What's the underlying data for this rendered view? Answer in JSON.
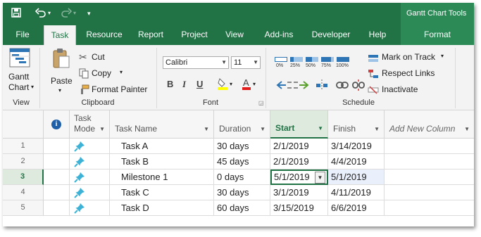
{
  "context_title": "Gantt Chart Tools",
  "tabs": [
    "File",
    "Task",
    "Resource",
    "Report",
    "Project",
    "View",
    "Add-ins",
    "Developer",
    "Help"
  ],
  "context_tab": "Format",
  "ribbon": {
    "view": {
      "gantt_line1": "Gantt",
      "gantt_line2": "Chart",
      "label": "View"
    },
    "clipboard": {
      "paste": "Paste",
      "cut": "Cut",
      "copy": "Copy",
      "format_painter": "Format Painter",
      "label": "Clipboard"
    },
    "font": {
      "name": "Calibri",
      "size": "11",
      "bold": "B",
      "italic": "I",
      "underline": "U",
      "label": "Font"
    },
    "schedule": {
      "percents": [
        "0%",
        "25%",
        "50%",
        "75%",
        "100%"
      ],
      "mark_on_track": "Mark on Track",
      "respect_links": "Respect Links",
      "inactivate": "Inactivate",
      "label": "Schedule"
    }
  },
  "columns": {
    "info": "i",
    "mode_line1": "Task",
    "mode_line2": "Mode",
    "name": "Task Name",
    "duration": "Duration",
    "start": "Start",
    "finish": "Finish",
    "add": "Add New Column"
  },
  "rows": [
    {
      "id": "1",
      "name": "Task A",
      "duration": "30 days",
      "start": "2/1/2019",
      "finish": "3/14/2019"
    },
    {
      "id": "2",
      "name": "Task B",
      "duration": "45 days",
      "start": "2/1/2019",
      "finish": "4/4/2019"
    },
    {
      "id": "3",
      "name": "Milestone 1",
      "duration": "0 days",
      "start": "5/1/2019",
      "finish": "5/1/2019"
    },
    {
      "id": "4",
      "name": "Task C",
      "duration": "30 days",
      "start": "3/1/2019",
      "finish": "4/11/2019"
    },
    {
      "id": "5",
      "name": "Task D",
      "duration": "60 days",
      "start": "3/15/2019",
      "finish": "6/6/2019"
    }
  ],
  "colors": {
    "accent": "#217346",
    "pin": "#3cb3d6",
    "selected_row": "#eaf2ea"
  }
}
